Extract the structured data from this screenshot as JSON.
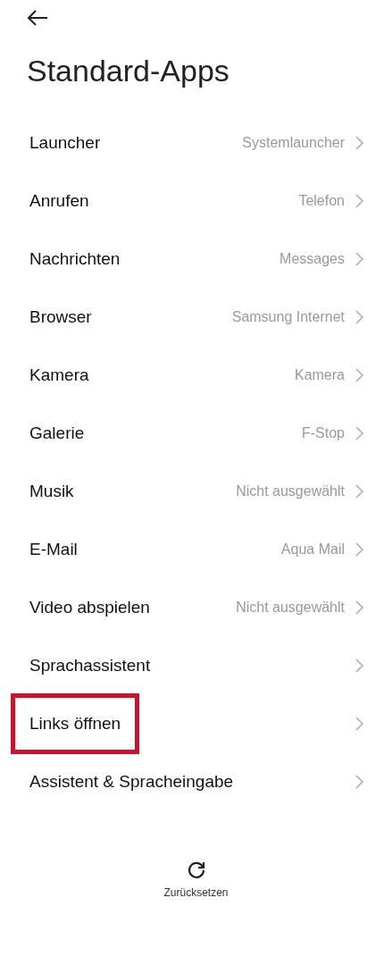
{
  "header": {
    "title": "Standard-Apps"
  },
  "items": [
    {
      "label": "Launcher",
      "value": "Systemlauncher",
      "highlighted": false
    },
    {
      "label": "Anrufen",
      "value": "Telefon",
      "highlighted": false
    },
    {
      "label": "Nachrichten",
      "value": "Messages",
      "highlighted": false
    },
    {
      "label": "Browser",
      "value": "Samsung Internet",
      "highlighted": false
    },
    {
      "label": "Kamera",
      "value": "Kamera",
      "highlighted": false
    },
    {
      "label": "Galerie",
      "value": "F-Stop",
      "highlighted": false
    },
    {
      "label": "Musik",
      "value": "Nicht ausgewählt",
      "highlighted": false
    },
    {
      "label": "E-Mail",
      "value": "Aqua Mail",
      "highlighted": false
    },
    {
      "label": "Video abspielen",
      "value": "Nicht ausgewählt",
      "highlighted": false
    },
    {
      "label": "Sprachassistent",
      "highlighted": false
    },
    {
      "label": "Links öffnen",
      "highlighted": true
    },
    {
      "label": "Assistent & Spracheingabe",
      "highlighted": false
    }
  ],
  "reset": {
    "label": "Zurücksetzen"
  }
}
